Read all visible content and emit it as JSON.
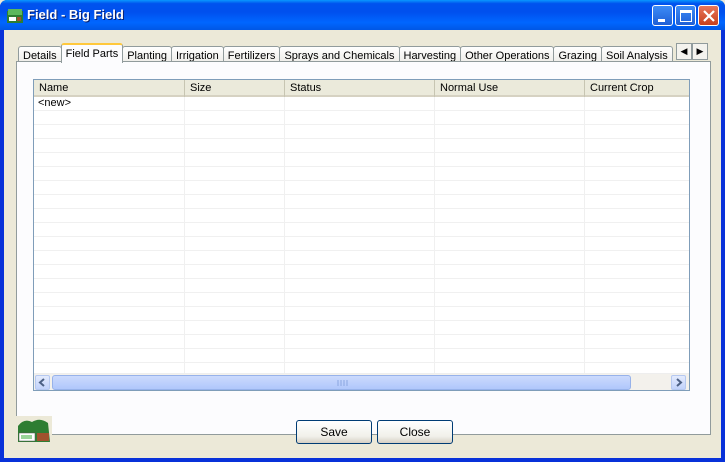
{
  "window": {
    "title": "Field - Big Field",
    "icon": "field-app-icon"
  },
  "titlebar_buttons": {
    "minimize": "minimize-icon",
    "maximize": "maximize-icon",
    "close": "close-icon"
  },
  "tabs": [
    {
      "label": "Details",
      "active": false
    },
    {
      "label": "Field Parts",
      "active": true
    },
    {
      "label": "Planting",
      "active": false
    },
    {
      "label": "Irrigation",
      "active": false
    },
    {
      "label": "Fertilizers",
      "active": false
    },
    {
      "label": "Sprays and Chemicals",
      "active": false
    },
    {
      "label": "Harvesting",
      "active": false
    },
    {
      "label": "Other Operations",
      "active": false
    },
    {
      "label": "Grazing",
      "active": false
    },
    {
      "label": "Soil Analysis",
      "active": false
    }
  ],
  "tab_scroll": {
    "left": "◀",
    "right": "▶"
  },
  "grid": {
    "columns": [
      "Name",
      "Size",
      "Status",
      "Normal Use",
      "Current Crop"
    ],
    "rows": [
      [
        "<new>",
        "",
        "",
        "",
        ""
      ]
    ],
    "empty_rows": 19
  },
  "scrollbar": {
    "left_arrow": "<",
    "right_arrow": ">",
    "grip": "|||"
  },
  "buttons": {
    "save": "Save",
    "close": "Close"
  },
  "colors": {
    "titlebar": "#0053ee",
    "active_tab_accent": "#ffc83c",
    "border": "#919b9c",
    "grid_border": "#7f9db9"
  }
}
